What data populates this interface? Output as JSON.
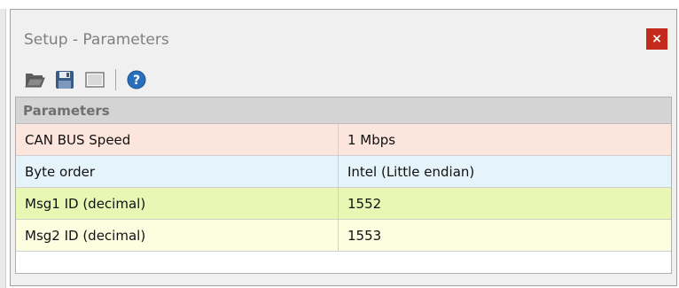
{
  "window": {
    "title": "Setup - Parameters",
    "close_label": "×"
  },
  "toolbar": {
    "buttons": [
      {
        "icon": "open-folder-icon"
      },
      {
        "icon": "save-disk-icon"
      },
      {
        "icon": "window-icon"
      },
      {
        "icon": "help-icon"
      }
    ]
  },
  "grid": {
    "header": "Parameters",
    "rows": [
      {
        "name": "CAN BUS Speed",
        "value": "1 Mbps",
        "color": "#fbe5dc"
      },
      {
        "name": "Byte order",
        "value": "Intel (Little endian)",
        "color": "#e5f4fb"
      },
      {
        "name": "Msg1 ID (decimal)",
        "value": "1552",
        "color": "#e9f7b4"
      },
      {
        "name": "Msg2 ID (decimal)",
        "value": "1553",
        "color": "#fdfde0"
      }
    ]
  }
}
